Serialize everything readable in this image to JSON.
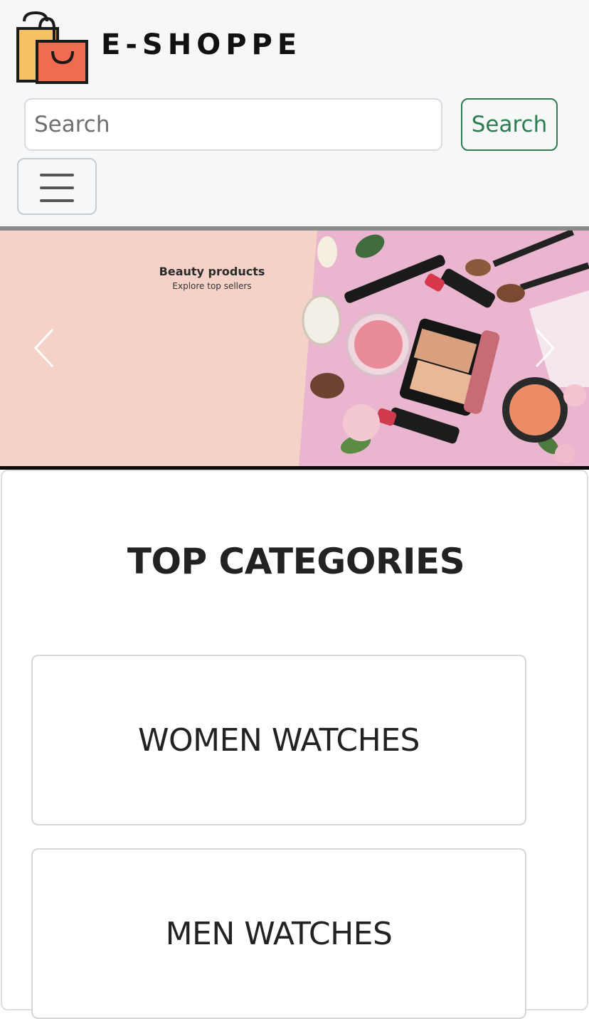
{
  "brand": {
    "name": "E-SHOPPE",
    "logo_icon": "shopping-bags-icon"
  },
  "search": {
    "placeholder": "Search",
    "value": "",
    "button_label": "Search",
    "accent_color": "#2e7d4f"
  },
  "nav": {
    "toggler_icon": "hamburger-menu-icon"
  },
  "carousel": {
    "slide_title": "Beauty products",
    "slide_subtitle": "Explore top sellers",
    "prev_icon": "chevron-left-icon",
    "next_icon": "chevron-right-icon",
    "background_color": "#f4d2c8"
  },
  "main": {
    "section_title": "TOP CATEGORIES",
    "categories": [
      {
        "label": "WOMEN WATCHES"
      },
      {
        "label": "MEN WATCHES"
      }
    ]
  }
}
